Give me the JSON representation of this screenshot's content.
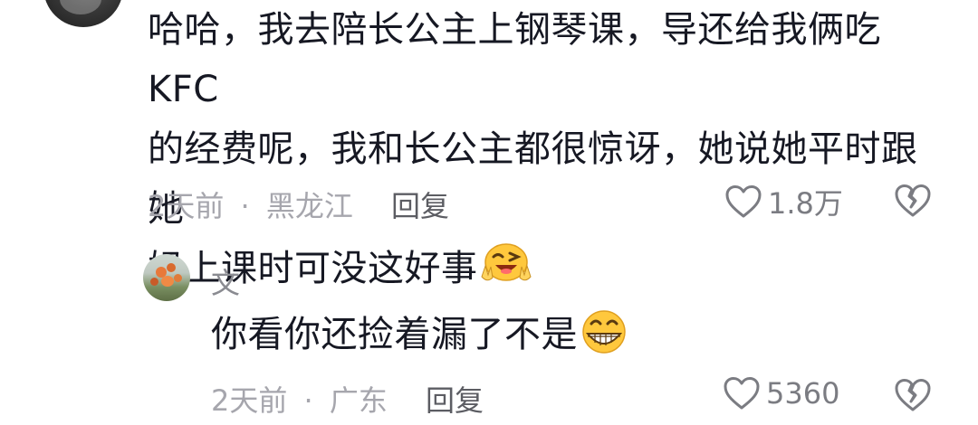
{
  "comment": {
    "lines": [
      "哈哈，我去陪长公主上钢琴课，导还给我俩吃KFC",
      "的经费呢，我和长公主都很惊讶，她说她平时跟她",
      "妈上课时可没这好事"
    ],
    "emoji": "wink-peace-emoji",
    "time": "2天前",
    "separator": "·",
    "location": "黑龙江",
    "reply_label": "回复",
    "likes": "1.8万"
  },
  "reply": {
    "username": "文",
    "text": "你看你还捡着漏了不是",
    "emoji": "grin-emoji",
    "time": "2天前",
    "separator": "·",
    "location": "广东",
    "reply_label": "回复",
    "likes": "5360"
  },
  "colors": {
    "text": "#161823",
    "meta": "#a6a6ad",
    "emoji_yellow": "#ffc83d"
  }
}
